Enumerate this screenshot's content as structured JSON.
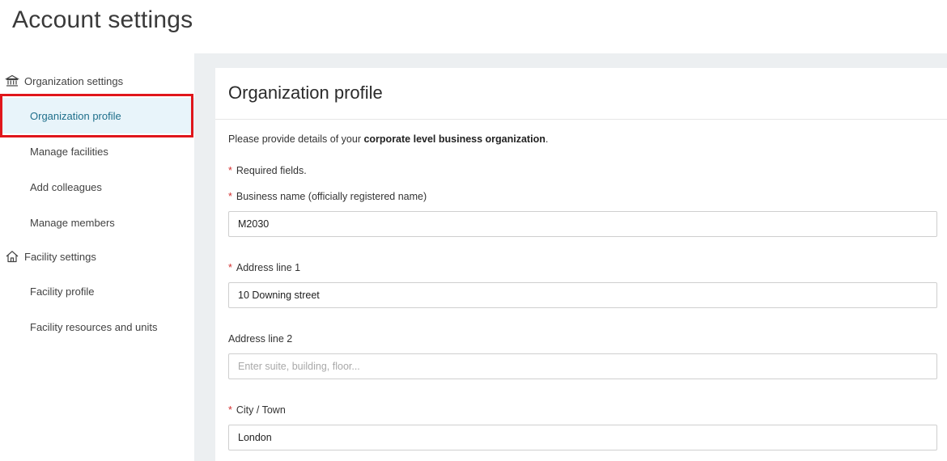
{
  "header": {
    "title": "Account settings"
  },
  "sidebar": {
    "organization": {
      "heading": "Organization settings",
      "icon": "bank-icon",
      "items": [
        {
          "label": "Organization profile",
          "active": true
        },
        {
          "label": "Manage facilities"
        },
        {
          "label": "Add colleagues"
        },
        {
          "label": "Manage members"
        }
      ]
    },
    "facility": {
      "heading": "Facility settings",
      "icon": "home-icon",
      "items": [
        {
          "label": "Facility profile"
        },
        {
          "label": "Facility resources and units"
        }
      ]
    }
  },
  "main": {
    "title": "Organization profile",
    "intro_prefix": "Please provide details of your ",
    "intro_bold": "corporate level business organization",
    "intro_suffix": ".",
    "required_note": "Required fields.",
    "fields": {
      "business_name": {
        "label": "Business name (officially registered name)",
        "value": "M2030",
        "required": true
      },
      "address1": {
        "label": "Address line 1",
        "value": "10 Downing street",
        "required": true
      },
      "address2": {
        "label": "Address line 2",
        "value": "",
        "placeholder": "Enter suite, building, floor...",
        "required": false
      },
      "city": {
        "label": "City / Town",
        "value": "London",
        "required": true
      }
    }
  },
  "colors": {
    "active_bg": "#e8f4fa",
    "active_text": "#1f6f8b",
    "highlight": "#e0161b",
    "required_star": "#d32f2f",
    "content_bg": "#eceff1"
  }
}
